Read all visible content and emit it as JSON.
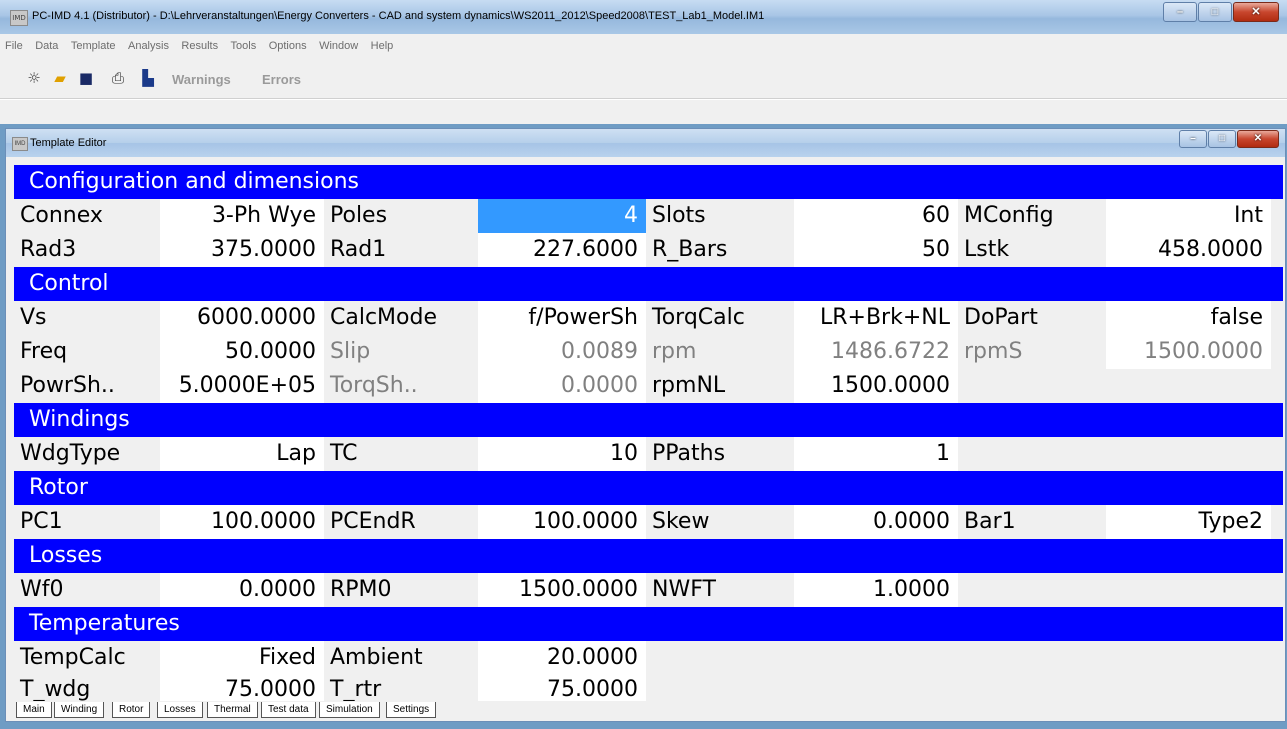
{
  "window": {
    "title": "PC-IMD 4.1 (Distributor) - D:\\Lehrveranstaltungen\\Energy Converters - CAD and system dynamics\\WS2011_2012\\Speed2008\\TEST_Lab1_Model.IM1"
  },
  "menu": [
    "File",
    "Data",
    "Template",
    "Analysis",
    "Results",
    "Tools",
    "Options",
    "Window",
    "Help"
  ],
  "toolbar": {
    "icons": [
      "new-icon",
      "open-folder-icon",
      "save-icon",
      "print-icon",
      "chart-icon"
    ],
    "warnings_label": "Warnings",
    "errors_label": "Errors"
  },
  "editor": {
    "title": "Template Editor",
    "sections": {
      "config": "Configuration and dimensions",
      "control": "Control",
      "windings": "Windings",
      "rotor": "Rotor",
      "losses": "Losses",
      "temps": "Temperatures"
    },
    "rows": {
      "r1": [
        "Connex",
        "3-Ph Wye",
        "Poles",
        "4",
        "Slots",
        "60",
        "MConfig",
        "Int"
      ],
      "r2": [
        "Rad3",
        "375.0000",
        "Rad1",
        "227.6000",
        "R_Bars",
        "50",
        "Lstk",
        "458.0000"
      ],
      "r3": [
        "Vs",
        "6000.0000",
        "CalcMode",
        "f/PowerSh",
        "TorqCalc",
        "LR+Brk+NL",
        "DoPart",
        "false"
      ],
      "r4": [
        "Freq",
        "50.0000",
        "Slip",
        "0.0089",
        "rpm",
        "1486.6722",
        "rpmS",
        "1500.0000"
      ],
      "r5": [
        "PowrSh..",
        "5.0000E+05",
        "TorqSh..",
        "0.0000",
        "rpmNL",
        "1500.0000",
        "",
        ""
      ],
      "r6": [
        "WdgType",
        "Lap",
        "TC",
        "10",
        "PPaths",
        "1",
        "",
        ""
      ],
      "r7": [
        "PC1",
        "100.0000",
        "PCEndR",
        "100.0000",
        "Skew",
        "0.0000",
        "Bar1",
        "Type2"
      ],
      "r8": [
        "Wf0",
        "0.0000",
        "RPM0",
        "1500.0000",
        "NWFT",
        "1.0000",
        "",
        ""
      ],
      "r9": [
        "TempCalc",
        "Fixed",
        "Ambient",
        "20.0000",
        "",
        "",
        "",
        ""
      ],
      "r10": [
        "T_wdg",
        "75.0000",
        "T_rtr",
        "75.0000",
        "",
        "",
        "",
        ""
      ]
    }
  },
  "tabs": [
    "Main",
    "Winding",
    "Rotor",
    "Losses",
    "Thermal",
    "Test data",
    "Simulation",
    "Settings"
  ],
  "colors": {
    "section": "#0000ff",
    "selected": "#3399ff"
  }
}
